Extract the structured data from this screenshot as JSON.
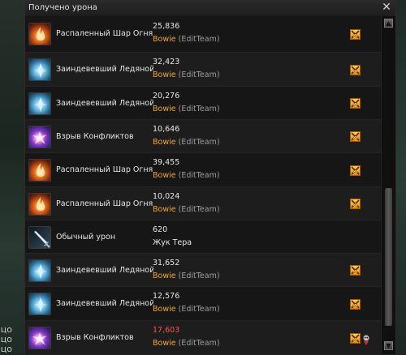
{
  "window": {
    "title": "Получено урона",
    "close_icon": "close-icon"
  },
  "background": {
    "left_text": [
      "оцо",
      "оцо",
      "оцо"
    ]
  },
  "rows": [
    {
      "skill": "Распаленный Шар Огня",
      "icon": "fire-orb-icon",
      "value": "25,836",
      "crit": false,
      "source_name": "Bowie",
      "source_team": " (EditTeam)",
      "source_plain": "",
      "badges": [
        "party-member-icon"
      ]
    },
    {
      "skill": "Заиндевевший Ледяной Шар",
      "icon": "ice-orb-icon",
      "value": "32,423",
      "crit": false,
      "source_name": "Bowie",
      "source_team": " (EditTeam)",
      "source_plain": "",
      "badges": [
        "party-member-icon"
      ]
    },
    {
      "skill": "Заиндевевший Ледяной Шар",
      "icon": "ice-orb-icon",
      "value": "20,276",
      "crit": false,
      "source_name": "Bowie",
      "source_team": " (EditTeam)",
      "source_plain": "",
      "badges": [
        "party-member-icon"
      ]
    },
    {
      "skill": "Взрыв Конфликтов",
      "icon": "conflict-blast-icon",
      "value": "10,646",
      "crit": false,
      "source_name": "Bowie",
      "source_team": " (EditTeam)",
      "source_plain": "",
      "badges": [
        "party-member-icon"
      ]
    },
    {
      "skill": "Распаленный Шар Огня",
      "icon": "fire-orb-icon",
      "value": "39,455",
      "crit": false,
      "source_name": "Bowie",
      "source_team": " (EditTeam)",
      "source_plain": "",
      "badges": [
        "party-member-icon"
      ]
    },
    {
      "skill": "Распаленный Шар Огня",
      "icon": "fire-orb-icon",
      "value": "10,024",
      "crit": false,
      "source_name": "Bowie",
      "source_team": " (EditTeam)",
      "source_plain": "",
      "badges": [
        "party-member-icon"
      ]
    },
    {
      "skill": "Обычный урон",
      "icon": "sword-icon",
      "value": "620",
      "crit": false,
      "source_name": "",
      "source_team": "",
      "source_plain": "Жук Тера",
      "badges": []
    },
    {
      "skill": "Заиндевевший Ледяной Шар",
      "icon": "ice-orb-icon",
      "value": "31,652",
      "crit": false,
      "source_name": "Bowie",
      "source_team": " (EditTeam)",
      "source_plain": "",
      "badges": [
        "party-member-icon"
      ]
    },
    {
      "skill": "Заиндевевший Ледяной Шар",
      "icon": "ice-orb-icon",
      "value": "12,576",
      "crit": false,
      "source_name": "Bowie",
      "source_team": " (EditTeam)",
      "source_plain": "",
      "badges": [
        "party-member-icon"
      ]
    },
    {
      "skill": "Взрыв Конфликтов",
      "icon": "conflict-blast-icon",
      "value": "17,603",
      "crit": true,
      "source_name": "Bowie",
      "source_team": " (EditTeam)",
      "source_plain": "",
      "badges": [
        "party-member-icon",
        "debuff-icon"
      ]
    }
  ],
  "scrollbar": {
    "up_icon": "scroll-up-icon",
    "down_icon": "scroll-down-icon"
  },
  "colors": {
    "source_name": "#f0a830",
    "crit_value": "#ff5252",
    "badge": "#f5a623"
  }
}
